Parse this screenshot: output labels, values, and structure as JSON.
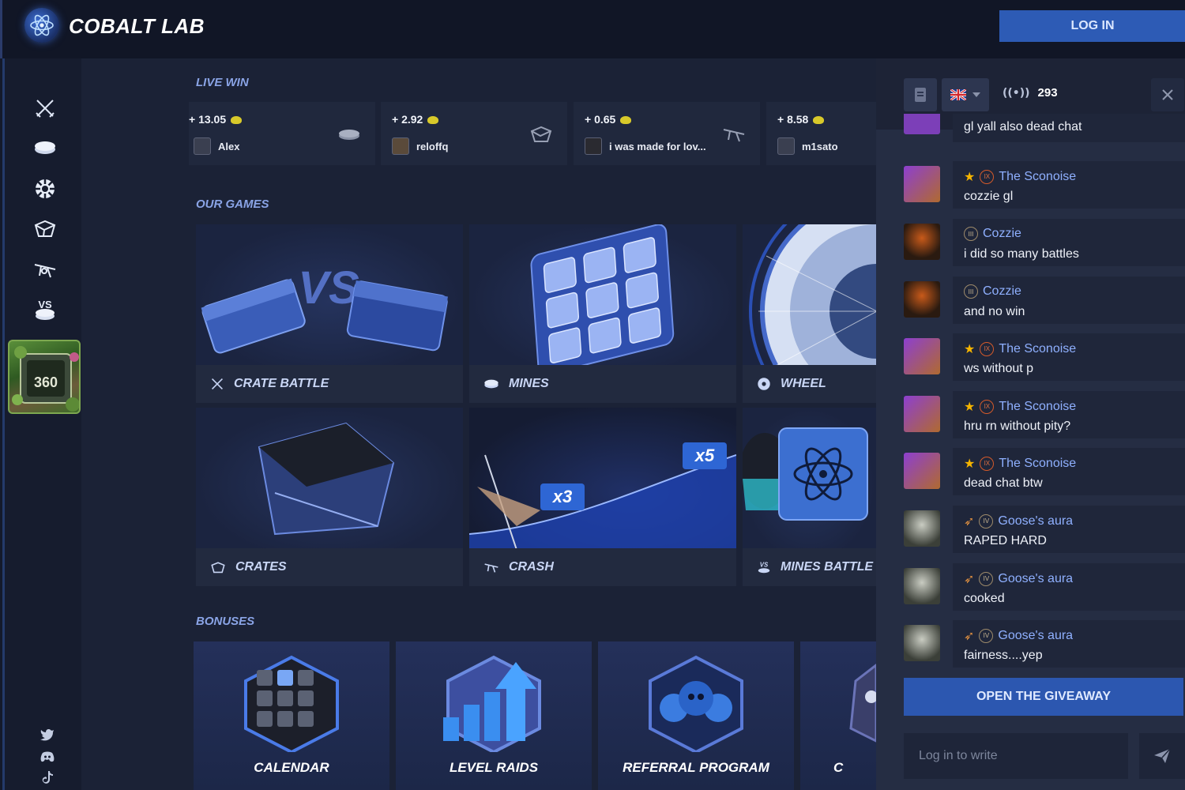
{
  "header": {
    "brand": "COBALT LAB",
    "login_label": "LOG IN"
  },
  "rail": {
    "icons": [
      "crossed-swords-icon",
      "mines-disc-icon",
      "wheel-icon",
      "crates-box-icon",
      "crash-glider-icon",
      "mines-battle-vs-icon"
    ],
    "social": [
      "twitter-icon",
      "discord-icon",
      "tiktok-icon"
    ]
  },
  "live_win": {
    "title": "LIVE WIN",
    "items": [
      {
        "amount": "+ 13.05",
        "user": "Alex",
        "game_icon": "mines-disc-icon"
      },
      {
        "amount": "+ 2.92",
        "user": "reloffq",
        "game_icon": "crates-box-icon"
      },
      {
        "amount": "+ 0.65",
        "user": "i was made for lov...",
        "game_icon": "crash-glider-icon"
      },
      {
        "amount": "+ 8.58",
        "user": "m1sato",
        "game_icon": "crates-box-icon"
      }
    ]
  },
  "games": {
    "title": "OUR GAMES",
    "items": [
      {
        "label": "CRATE BATTLE",
        "icon": "crossed-swords-icon"
      },
      {
        "label": "MINES",
        "icon": "mines-disc-icon"
      },
      {
        "label": "WHEEL",
        "icon": "wheel-icon"
      },
      {
        "label": "CRATES",
        "icon": "crates-box-icon"
      },
      {
        "label": "CRASH",
        "icon": "crash-glider-icon"
      },
      {
        "label": "MINES BATTLE",
        "icon": "mines-battle-vs-icon"
      }
    ],
    "crash_multipliers": [
      "x3",
      "x5"
    ]
  },
  "bonuses": {
    "title": "BONUSES",
    "items": [
      {
        "label": "CALENDAR"
      },
      {
        "label": "LEVEL RAIDS"
      },
      {
        "label": "REFERRAL PROGRAM"
      },
      {
        "label": "C"
      }
    ]
  },
  "chat": {
    "online_count": "293",
    "language": "gb-flag-icon",
    "messages": [
      {
        "name": "",
        "text": "gl yall also dead chat"
      },
      {
        "name": "The Sconoise",
        "text": "cozzie gl"
      },
      {
        "name": "Cozzie",
        "text": "i did so many battles"
      },
      {
        "name": "Cozzie",
        "text": "and no win"
      },
      {
        "name": "The Sconoise",
        "text": "ws without p"
      },
      {
        "name": "The Sconoise",
        "text": "hru rn without pity?"
      },
      {
        "name": "The Sconoise",
        "text": "dead chat btw"
      },
      {
        "name": "Goose's aura",
        "text": "RAPED HARD"
      },
      {
        "name": "Goose's aura",
        "text": "cooked"
      },
      {
        "name": "Goose's aura",
        "text": "fairness....yep"
      }
    ],
    "giveaway_label": "OPEN THE GIVEAWAY",
    "input_placeholder": "Log in to write"
  },
  "colors": {
    "accent": "#2d5bb5",
    "background": "#141a2b",
    "chat_name": "#8fb0ff"
  }
}
